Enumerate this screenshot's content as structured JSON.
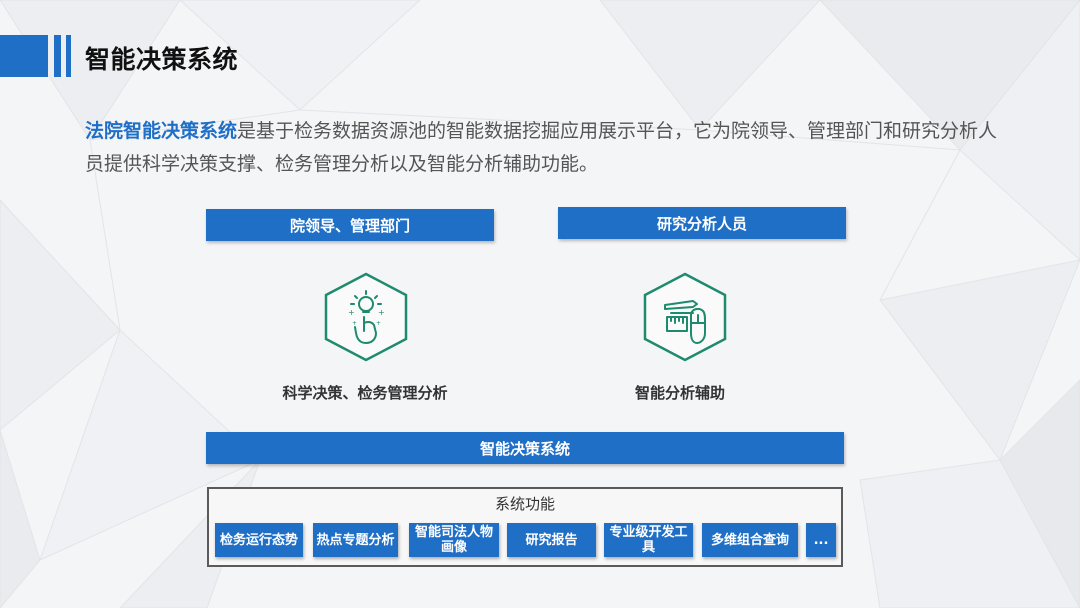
{
  "header": {
    "title": "智能决策系统"
  },
  "intro": {
    "highlight": "法院智能决策系统",
    "text": "是基于检务数据资源池的智能数据挖掘应用展示平台，它为院领导、管理部门和研究分析人员提供科学决策支撑、检务管理分析以及智能分析辅助功能。"
  },
  "diagram": {
    "user_left": "院领导、管理部门",
    "user_right": "研究分析人员",
    "cap_left": "科学决策、检务管理分析",
    "cap_right": "智能分析辅助",
    "system_bar": "智能决策系统",
    "icon_left": "idea-hand-icon",
    "icon_right": "tools-mouse-icon",
    "accent_color": "#1f6fc7",
    "icon_color": "#1e8a6e"
  },
  "functions": {
    "title": "系统功能",
    "items": [
      "检务运行态势",
      "热点专题分析",
      "智能司法人物画像",
      "研究报告",
      "专业级开发工具",
      "多维组合查询",
      "..."
    ]
  }
}
